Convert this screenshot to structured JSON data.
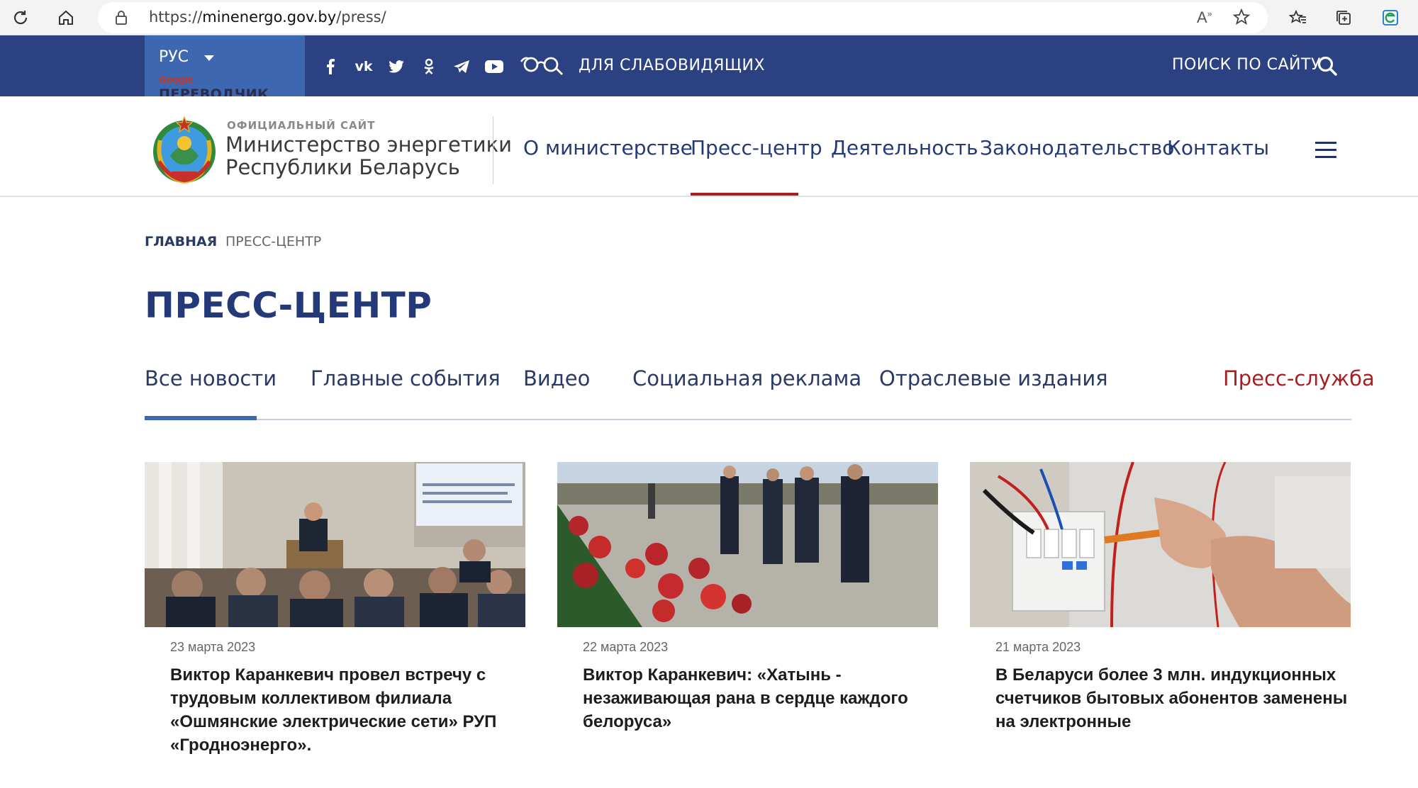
{
  "browser": {
    "url_scheme": "https://",
    "url_host": "minenergo.gov.by",
    "url_path": "/press/"
  },
  "topbar": {
    "language": "РУС",
    "translator_brand": "Google",
    "translator_label": "ПЕРЕВОДЧИК",
    "social_icons": [
      "facebook-icon",
      "vk-icon",
      "twitter-icon",
      "odnoklassniki-icon",
      "telegram-icon",
      "youtube-icon"
    ],
    "visually_impaired_label": "ДЛЯ СЛАБОВИДЯЩИХ",
    "search_label": "ПОИСК ПО САЙТУ"
  },
  "header": {
    "kicker": "ОФИЦИАЛЬНЫЙ САЙТ",
    "site_name_line1": "Министерство энергетики",
    "site_name_line2": "Республики Беларусь",
    "nav": [
      "О министерстве",
      "Пресс-центр",
      "Деятельность",
      "Законодательство",
      "Контакты"
    ],
    "active_nav": "Пресс-центр"
  },
  "breadcrumb": {
    "home": "ГЛАВНАЯ",
    "separator": "›",
    "current": "ПРЕСС-ЦЕНТР"
  },
  "page_title": "ПРЕСС-ЦЕНТР",
  "tabs": [
    "Все новости",
    "Главные события",
    "Видео",
    "Социальная реклама",
    "Отраслевые издания",
    "Пресс-служба"
  ],
  "active_tab": "Все новости",
  "news": [
    {
      "date": "23 марта 2023",
      "title": "Виктор Каранкевич провел встречу с трудовым коллективом филиала «Ошмянские электрические сети» РУП «Гродноэнерго»."
    },
    {
      "date": "22 марта 2023",
      "title": "Виктор Каранкевич: «Хатынь - незаживающая рана в сердце каждого белоруса»"
    },
    {
      "date": "21 марта 2023",
      "title": "В Беларуси более 3 млн. индукционных счетчиков бытовых абонентов заменены на электронные"
    }
  ],
  "colors": {
    "topbar": "#2b4182",
    "lang_box": "#3d67b1",
    "primary_text": "#243a78",
    "accent_red": "#a81e22"
  }
}
